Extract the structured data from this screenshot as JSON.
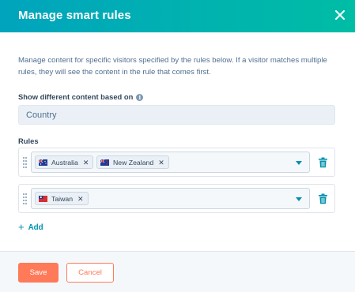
{
  "header": {
    "title": "Manage smart rules",
    "close_icon": "close-icon",
    "gradient": [
      "#00a4bd",
      "#00bda5"
    ]
  },
  "description": "Manage content for specific visitors specified by the rules below. If a visitor matches multiple rules, they will see the content in the rule that comes first.",
  "show_based_on": {
    "label": "Show different content based on",
    "info_icon": "info-icon",
    "value": "Country"
  },
  "rules": {
    "label": "Rules",
    "items": [
      {
        "tags": [
          {
            "label": "Australia",
            "flag": "australia-flag"
          },
          {
            "label": "New Zealand",
            "flag": "new-zealand-flag"
          }
        ]
      },
      {
        "tags": [
          {
            "label": "Taiwan",
            "flag": "taiwan-flag"
          }
        ]
      }
    ],
    "add_label": "Add",
    "remove_glyph": "✕"
  },
  "footer": {
    "save_label": "Save",
    "cancel_label": "Cancel"
  },
  "colors": {
    "accent": "#0091ae",
    "primary_button": "#ff7a59",
    "text": "#33475b",
    "muted_text": "#516f90"
  }
}
